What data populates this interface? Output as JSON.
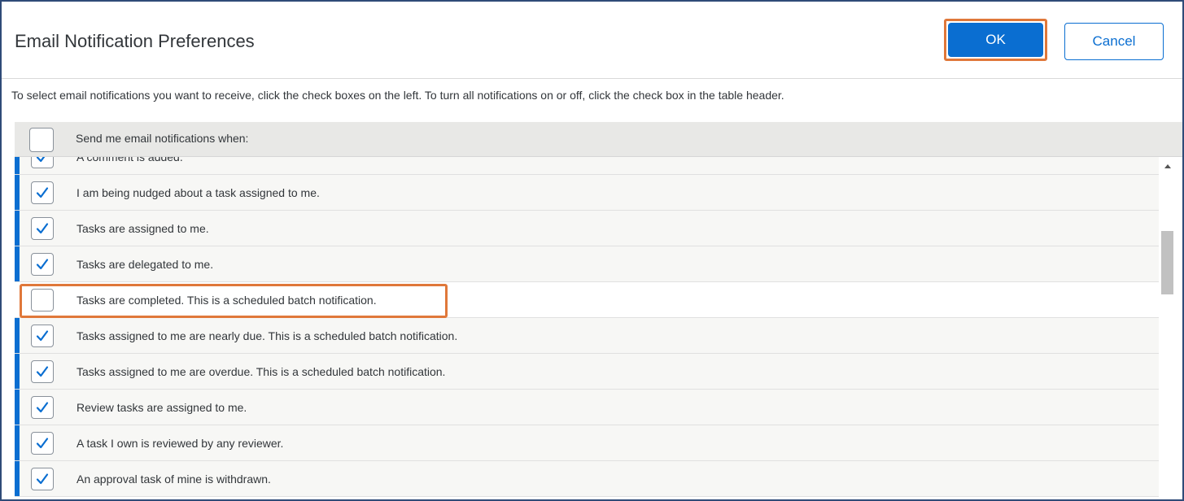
{
  "dialog": {
    "title": "Email Notification Preferences",
    "ok_label": "OK",
    "cancel_label": "Cancel",
    "instructions": "To select email notifications you want to receive, click the check boxes on the left. To turn all notifications on or off, click the check box in the table header."
  },
  "table": {
    "header_label": "Send me email notifications when:",
    "header_checked": false,
    "rows": [
      {
        "label": "A comment is added.",
        "checked": true
      },
      {
        "label": "I am being nudged about a task assigned to me.",
        "checked": true
      },
      {
        "label": "Tasks are assigned to me.",
        "checked": true
      },
      {
        "label": "Tasks are delegated to me.",
        "checked": true
      },
      {
        "label": "Tasks are completed. This is a scheduled batch notification.",
        "checked": false
      },
      {
        "label": "Tasks assigned to me are nearly due. This is a scheduled batch notification.",
        "checked": true
      },
      {
        "label": "Tasks assigned to me are overdue. This is a scheduled batch notification.",
        "checked": true
      },
      {
        "label": "Review tasks are assigned to me.",
        "checked": true
      },
      {
        "label": "A task I own is reviewed by any reviewer.",
        "checked": true
      },
      {
        "label": "An approval task of mine is withdrawn.",
        "checked": true
      }
    ]
  },
  "colors": {
    "accent": "#0a6ed1",
    "highlight": "#e0783a",
    "border": "#2f4b78"
  }
}
